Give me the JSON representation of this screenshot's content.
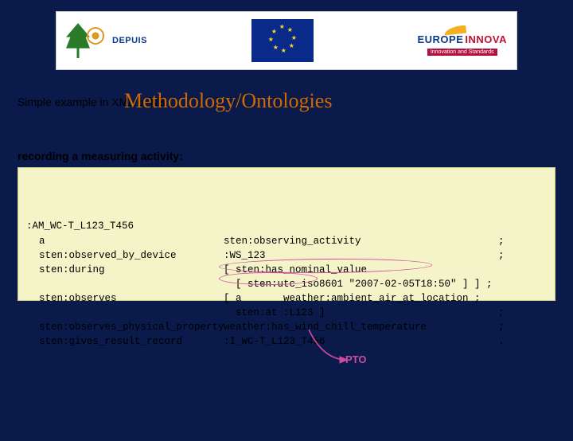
{
  "header": {
    "logo_left_name": "DEPUIS",
    "logo_right_top": "EUROPE",
    "logo_right_bottom": "INNOVA",
    "logo_right_tagline": "Innovation and Standards"
  },
  "title_row": {
    "small_label": "Simple example in XML or N3",
    "big_title": "Methodology/Ontologies"
  },
  "subheading": "recording a measuring activity:",
  "code": {
    "lines": [
      {
        "left": ":AM_WC-T_L123_T456",
        "right": ""
      },
      {
        "left": "a",
        "right": "sten:observing_activity                       ;"
      },
      {
        "left": "sten:observed_by_device",
        "right": ":WS_123                                       ;"
      },
      {
        "left": "sten:during",
        "right": "[ sten:has_nominal_value"
      },
      {
        "left": "",
        "right": "  [ sten:utc_iso8601 \"2007-02-05T18:50\" ] ] ;"
      },
      {
        "left": "sten:observes",
        "right": "[ a       weather:ambient_air_at_location ;"
      },
      {
        "left": "",
        "right": "  sten:at :L123 ]                             ;"
      },
      {
        "left": "sten:observes_physical_property",
        "right": "weather:has_wind_chill_temperature            ;"
      },
      {
        "left": "sten:gives_result_record",
        "right": ":I_WC-T_L123_T456                             ."
      }
    ]
  },
  "pto_label": "PTO"
}
